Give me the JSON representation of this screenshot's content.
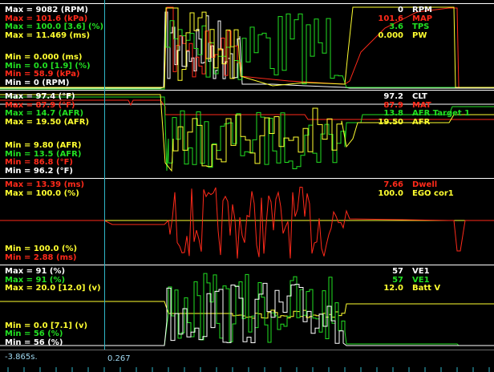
{
  "colors": {
    "white": "#ffffff",
    "red": "#ff2a1a",
    "green": "#22e022",
    "yellow": "#ffff30",
    "cyan": "#2fb6c8"
  },
  "panels": [
    {
      "left_top": [
        {
          "text": "Max = 9082 (RPM)",
          "color": "white"
        },
        {
          "text": "Max = 101.6 (kPa)",
          "color": "red"
        },
        {
          "text": "Max = 100.0 [3.6] (%)",
          "color": "green"
        },
        {
          "text": "Max = 11.469 (ms)",
          "color": "yellow"
        }
      ],
      "left_bottom": [
        {
          "text": "Min = 0.000 (ms)",
          "color": "yellow"
        },
        {
          "text": "Min = 0.0 [1.9] (%)",
          "color": "green"
        },
        {
          "text": "Min = 58.9 (kPa)",
          "color": "red"
        },
        {
          "text": "Min = 0 (RPM)",
          "color": "white"
        }
      ],
      "right": [
        {
          "value": "0",
          "name": "RPM",
          "color": "white"
        },
        {
          "value": "101.6",
          "name": "MAP",
          "color": "red"
        },
        {
          "value": "3.6",
          "name": "TPS",
          "color": "green"
        },
        {
          "value": "0.000",
          "name": "PW",
          "color": "yellow"
        }
      ]
    },
    {
      "left_top": [
        {
          "text": "Max = 97.4 (°F)",
          "color": "white"
        },
        {
          "text": "Max = 87.9 (°F)",
          "color": "red"
        },
        {
          "text": "Max = 14.7 (AFR)",
          "color": "green"
        },
        {
          "text": "Max = 19.50 (AFR)",
          "color": "yellow"
        }
      ],
      "left_bottom": [
        {
          "text": "Min = 9.80 (AFR)",
          "color": "yellow"
        },
        {
          "text": "Min = 13.5 (AFR)",
          "color": "green"
        },
        {
          "text": "Min = 86.8 (°F)",
          "color": "red"
        },
        {
          "text": "Min = 96.2 (°F)",
          "color": "white"
        }
      ],
      "right": [
        {
          "value": "97.2",
          "name": "CLT",
          "color": "white"
        },
        {
          "value": "87.9",
          "name": "MAT",
          "color": "red"
        },
        {
          "value": "13.8",
          "name": "AFR Target 1",
          "color": "green"
        },
        {
          "value": "19.50",
          "name": "AFR",
          "color": "yellow"
        }
      ]
    },
    {
      "left_top": [
        {
          "text": "Max = 13.39 (ms)",
          "color": "red"
        },
        {
          "text": "Max = 100.0 (%)",
          "color": "yellow"
        }
      ],
      "left_bottom": [
        {
          "text": "Min = 100.0 (%)",
          "color": "yellow"
        },
        {
          "text": "Min = 2.88 (ms)",
          "color": "red"
        }
      ],
      "right": [
        {
          "value": "7.66",
          "name": "Dwell",
          "color": "red"
        },
        {
          "value": "100.0",
          "name": "EGO cor1",
          "color": "yellow"
        }
      ]
    },
    {
      "left_top": [
        {
          "text": "Max = 91 (%)",
          "color": "white"
        },
        {
          "text": "Max = 91 (%)",
          "color": "green"
        },
        {
          "text": "Max = 20.0 [12.0] (v)",
          "color": "yellow"
        }
      ],
      "left_bottom": [
        {
          "text": "Min = 0.0 [7.1] (v)",
          "color": "yellow"
        },
        {
          "text": "Min = 56 (%)",
          "color": "green"
        },
        {
          "text": "Min = 56 (%)",
          "color": "white"
        }
      ],
      "right": [
        {
          "value": "57",
          "name": "VE1",
          "color": "white"
        },
        {
          "value": "57",
          "name": "VE1",
          "color": "green"
        },
        {
          "value": "12.0",
          "name": "Batt V",
          "color": "yellow"
        }
      ]
    }
  ],
  "footer": {
    "time_offset": "-3.865s.",
    "cursor_time": "0.267"
  }
}
